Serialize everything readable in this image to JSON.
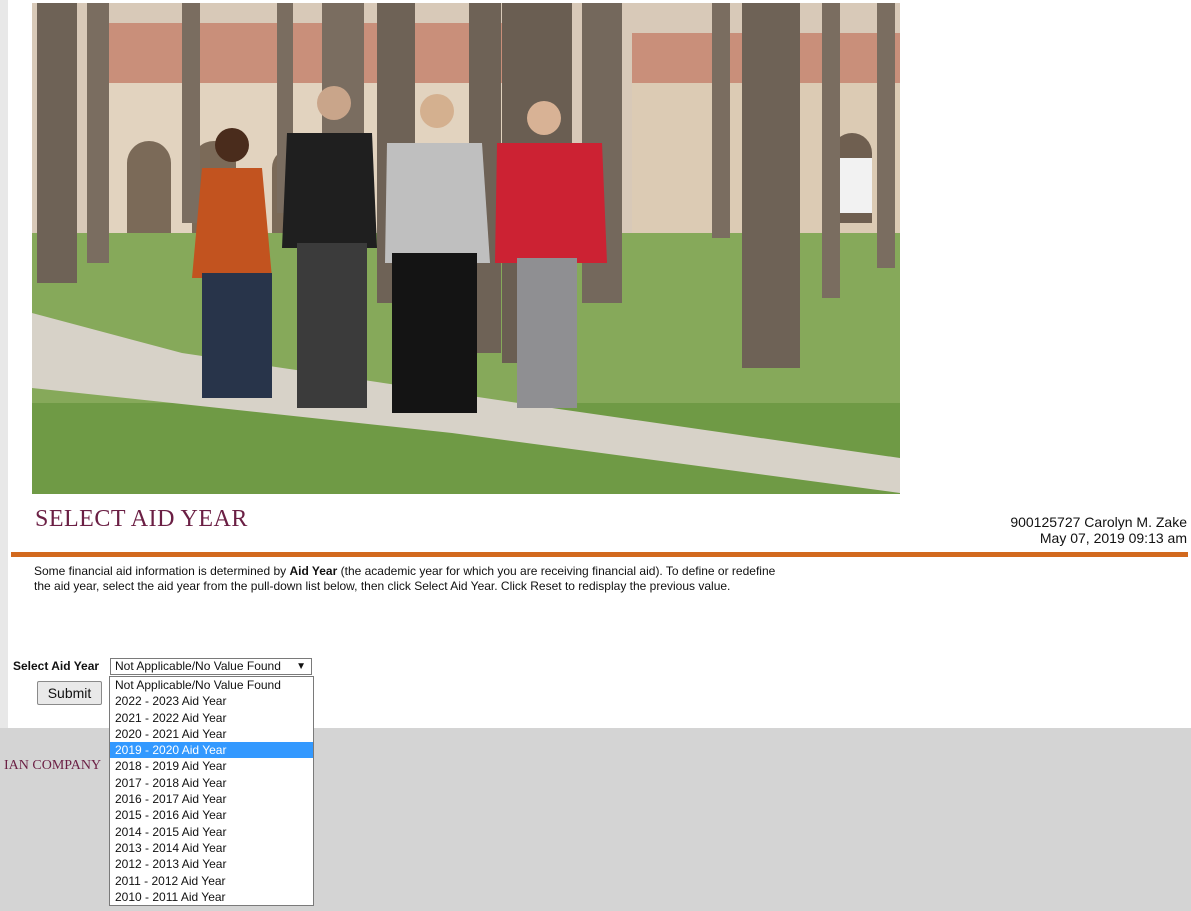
{
  "header": {
    "title": "SELECT AID YEAR",
    "user_line": "900125727 Carolyn M. Zake",
    "datetime": "May 07, 2019 09:13 am"
  },
  "info": {
    "text_before": "Some financial aid information is determined by ",
    "bold": "Aid Year",
    "text_after": " (the academic year for which you are receiving financial aid). To define or redefine the aid year, select the aid year from the pull-down list below, then click Select Aid Year. Click Reset to redisplay the previous value."
  },
  "form": {
    "label": "Select Aid Year",
    "selected_value": "Not Applicable/No Value Found",
    "submit_label": "Submit",
    "highlighted_index": 4,
    "options": [
      "Not Applicable/No Value Found",
      "2022 - 2023 Aid Year",
      "2021 - 2022 Aid Year",
      "2020 - 2021 Aid Year",
      "2019 - 2020 Aid Year",
      "2018 - 2019 Aid Year",
      "2017 - 2018 Aid Year",
      "2016 - 2017 Aid Year",
      "2015 - 2016 Aid Year",
      "2014 - 2015 Aid Year",
      "2013 - 2014 Aid Year",
      "2012 - 2013 Aid Year",
      "2011 - 2012 Aid Year",
      "2010 - 2011 Aid Year"
    ]
  },
  "footer": {
    "text": "IAN COMPANY"
  },
  "colors": {
    "title": "#6b1f44",
    "rule": "#d2691e",
    "highlight": "#3399ff",
    "footer_bg": "#d4d4d4"
  }
}
